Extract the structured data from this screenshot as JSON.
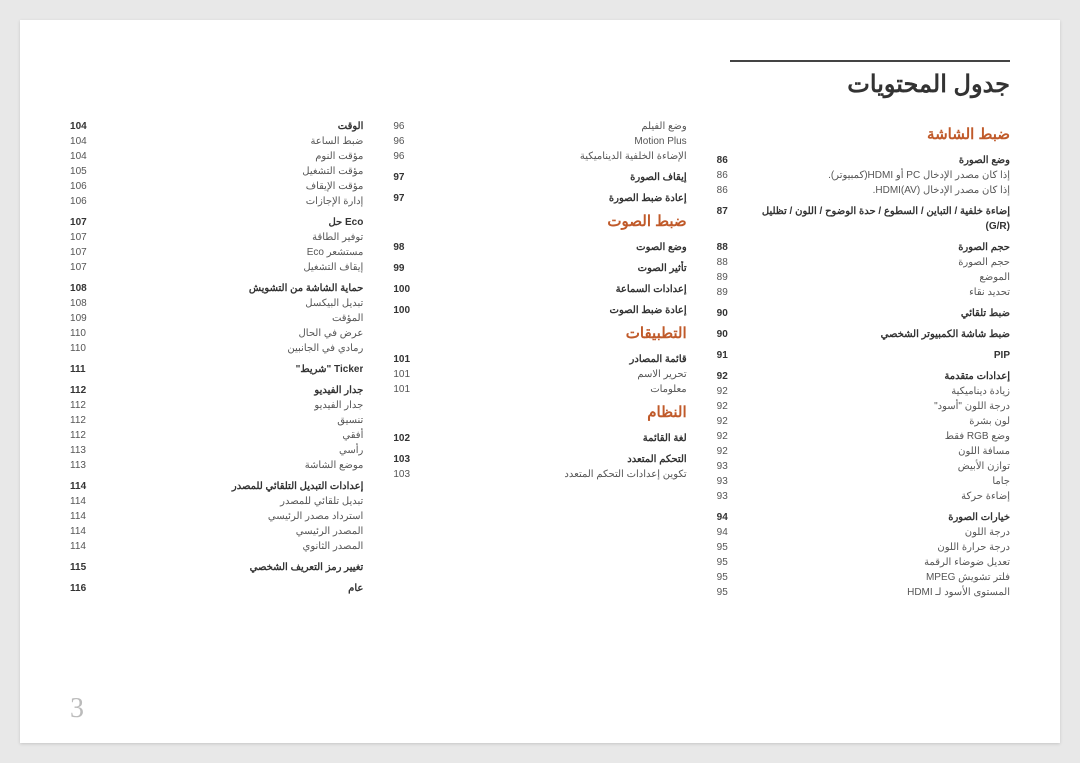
{
  "title": "جدول المحتويات",
  "pageNumber": "3",
  "columns": [
    {
      "sections": [
        {
          "heading": "ضبط الشاشة",
          "groups": [
            {
              "rows": [
                {
                  "label": "وضع الصورة",
                  "page": "86",
                  "bold": true
                },
                {
                  "label": "إذا كان مصدر الإدخال PC أو HDMI(كمبيوتر).",
                  "page": "86"
                },
                {
                  "label": "إذا كان مصدر الإدخال HDMI(AV).",
                  "page": "86"
                }
              ]
            },
            {
              "rows": [
                {
                  "label": "إضاءة خلفية / التباين / السطوع / حدة الوضوح / اللون / تظليل",
                  "page": "87",
                  "bold": true
                },
                {
                  "label": "(G/R)",
                  "page": "",
                  "bold": true
                }
              ]
            },
            {
              "rows": [
                {
                  "label": "حجم الصورة",
                  "page": "88",
                  "bold": true
                },
                {
                  "label": "حجم الصورة",
                  "page": "88"
                },
                {
                  "label": "الموضع",
                  "page": "89"
                },
                {
                  "label": "تحديد نقاء",
                  "page": "89"
                }
              ]
            },
            {
              "rows": [
                {
                  "label": "ضبط تلقائي",
                  "page": "90",
                  "bold": true
                }
              ]
            },
            {
              "rows": [
                {
                  "label": "ضبط شاشة الكمبيوتر الشخصي",
                  "page": "90",
                  "bold": true
                }
              ]
            },
            {
              "rows": [
                {
                  "label": "PIP",
                  "page": "91",
                  "bold": true
                }
              ]
            },
            {
              "rows": [
                {
                  "label": "إعدادات متقدمة",
                  "page": "92",
                  "bold": true
                },
                {
                  "label": "زيادة ديناميكية",
                  "page": "92"
                },
                {
                  "label": "درجة اللون \"أسود\"",
                  "page": "92"
                },
                {
                  "label": "لون بشرة",
                  "page": "92"
                },
                {
                  "label": "وضع RGB فقط",
                  "page": "92"
                },
                {
                  "label": "مسافة اللون",
                  "page": "92"
                },
                {
                  "label": "توازن الأبيض",
                  "page": "93"
                },
                {
                  "label": "جاما",
                  "page": "93"
                },
                {
                  "label": "إضاءة حركة",
                  "page": "93"
                }
              ]
            },
            {
              "rows": [
                {
                  "label": "خيارات الصورة",
                  "page": "94",
                  "bold": true
                },
                {
                  "label": "درجة اللون",
                  "page": "94"
                },
                {
                  "label": "درجة حرارة اللون",
                  "page": "95"
                },
                {
                  "label": "تعديل ضوضاء الرقمة",
                  "page": "95"
                },
                {
                  "label": "فلتر تشويش MPEG",
                  "page": "95"
                },
                {
                  "label": "المستوى الأسود لـ HDMI",
                  "page": "95"
                }
              ]
            }
          ]
        }
      ]
    },
    {
      "sections": [
        {
          "heading": "",
          "groups": [
            {
              "rows": [
                {
                  "label": "وضع الفيلم",
                  "page": "96"
                },
                {
                  "label": "Motion Plus",
                  "page": "96"
                },
                {
                  "label": "الإضاءة الخلفية الديناميكية",
                  "page": "96"
                }
              ]
            },
            {
              "rows": [
                {
                  "label": "إيقاف الصورة",
                  "page": "97",
                  "bold": true
                }
              ]
            },
            {
              "rows": [
                {
                  "label": "إعادة ضبط الصورة",
                  "page": "97",
                  "bold": true
                }
              ]
            }
          ]
        },
        {
          "heading": "ضبط الصوت",
          "groups": [
            {
              "rows": [
                {
                  "label": "وضع الصوت",
                  "page": "98",
                  "bold": true
                }
              ]
            },
            {
              "rows": [
                {
                  "label": "تأثير الصوت",
                  "page": "99",
                  "bold": true
                }
              ]
            },
            {
              "rows": [
                {
                  "label": "إعدادات السماعة",
                  "page": "100",
                  "bold": true
                }
              ]
            },
            {
              "rows": [
                {
                  "label": "إعادة ضبط الصوت",
                  "page": "100",
                  "bold": true
                }
              ]
            }
          ]
        },
        {
          "heading": "التطبيقات",
          "groups": [
            {
              "rows": [
                {
                  "label": "قائمة المصادر",
                  "page": "101",
                  "bold": true
                },
                {
                  "label": "تحرير الاسم",
                  "page": "101"
                },
                {
                  "label": "معلومات",
                  "page": "101"
                }
              ]
            }
          ]
        },
        {
          "heading": "النظام",
          "groups": [
            {
              "rows": [
                {
                  "label": "لغة القائمة",
                  "page": "102",
                  "bold": true
                }
              ]
            },
            {
              "rows": [
                {
                  "label": "التحكم المتعدد",
                  "page": "103",
                  "bold": true
                },
                {
                  "label": "تكوين إعدادات التحكم المتعدد",
                  "page": "103"
                }
              ]
            }
          ]
        }
      ]
    },
    {
      "sections": [
        {
          "heading": "",
          "groups": [
            {
              "rows": [
                {
                  "label": "الوقت",
                  "page": "104",
                  "bold": true
                },
                {
                  "label": "ضبط الساعة",
                  "page": "104"
                },
                {
                  "label": "مؤقت النوم",
                  "page": "104"
                },
                {
                  "label": "مؤقت التشغيل",
                  "page": "105"
                },
                {
                  "label": "مؤقت الإيقاف",
                  "page": "106"
                },
                {
                  "label": "إدارة الإجازات",
                  "page": "106"
                }
              ]
            },
            {
              "rows": [
                {
                  "label": "Eco حل",
                  "page": "107",
                  "bold": true
                },
                {
                  "label": "توفير الطاقة",
                  "page": "107"
                },
                {
                  "label": "مستشعر Eco",
                  "page": "107"
                },
                {
                  "label": "إيقاف التشغيل",
                  "page": "107"
                }
              ]
            },
            {
              "rows": [
                {
                  "label": "حماية الشاشة من التشويش",
                  "page": "108",
                  "bold": true
                },
                {
                  "label": "تبديل البيكسل",
                  "page": "108"
                },
                {
                  "label": "المؤقت",
                  "page": "109"
                },
                {
                  "label": "عرض في الحال",
                  "page": "110"
                },
                {
                  "label": "رمادي في الجانبين",
                  "page": "110"
                }
              ]
            },
            {
              "rows": [
                {
                  "label": "Ticker \"شريط\"",
                  "page": "111",
                  "bold": true
                }
              ]
            },
            {
              "rows": [
                {
                  "label": "جدار الفيديو",
                  "page": "112",
                  "bold": true
                },
                {
                  "label": "جدار الفيديو",
                  "page": "112"
                },
                {
                  "label": "تنسيق",
                  "page": "112"
                },
                {
                  "label": "أفقي",
                  "page": "112"
                },
                {
                  "label": "رأسي",
                  "page": "113"
                },
                {
                  "label": "موضع الشاشة",
                  "page": "113"
                }
              ]
            },
            {
              "rows": [
                {
                  "label": "إعدادات التبديل التلقائي للمصدر",
                  "page": "114",
                  "bold": true
                },
                {
                  "label": "تبديل تلقائي للمصدر",
                  "page": "114"
                },
                {
                  "label": "استرداد مصدر الرئيسي",
                  "page": "114"
                },
                {
                  "label": "المصدر الرئيسي",
                  "page": "114"
                },
                {
                  "label": "المصدر الثانوي",
                  "page": "114"
                }
              ]
            },
            {
              "rows": [
                {
                  "label": "تغيير رمز التعريف الشخصي",
                  "page": "115",
                  "bold": true
                }
              ]
            },
            {
              "rows": [
                {
                  "label": "عام",
                  "page": "116",
                  "bold": true
                }
              ]
            }
          ]
        }
      ]
    }
  ]
}
